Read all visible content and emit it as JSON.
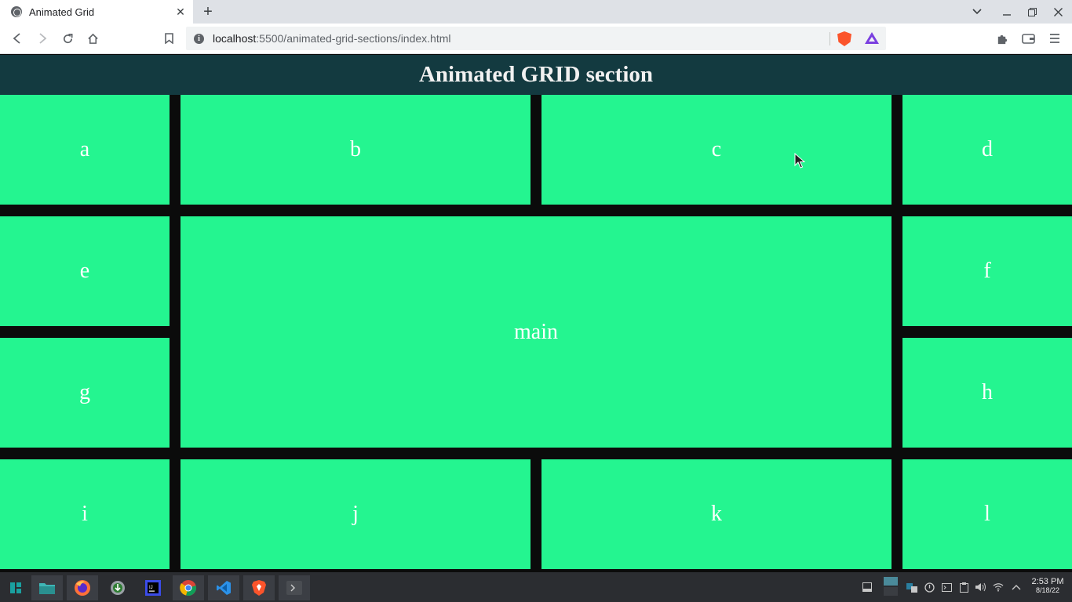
{
  "browser": {
    "tab_title": "Animated Grid",
    "tab_close": "✕",
    "new_tab": "+",
    "url_host": "localhost",
    "url_path": ":5500/animated-grid-sections/index.html",
    "icons": [
      "back-icon",
      "forward-icon",
      "reload-icon",
      "home-icon",
      "bookmark-icon",
      "site-info-icon",
      "brave-shields-icon",
      "brave-rewards-icon",
      "extensions-icon",
      "wallet-icon",
      "menu-icon"
    ]
  },
  "page": {
    "title": "Animated GRID section",
    "cells": {
      "a": "a",
      "b": "b",
      "c": "c",
      "d": "d",
      "e": "e",
      "main": "main",
      "f": "f",
      "g": "g",
      "h": "h",
      "i": "i",
      "j": "j",
      "k": "k",
      "l": "l"
    },
    "colors": {
      "header": "#133a40",
      "cell": "#24f590",
      "background": "#0b0b0b",
      "text": "#ffffff"
    }
  },
  "taskbar": {
    "apps": [
      "app-menu-icon",
      "files-icon",
      "firefox-icon",
      "downloader-icon",
      "intellij-icon",
      "chrome-icon",
      "vscode-icon",
      "brave-icon",
      "terminal-icon"
    ],
    "clock_time": "2:53 PM",
    "clock_date": "8/18/22"
  }
}
